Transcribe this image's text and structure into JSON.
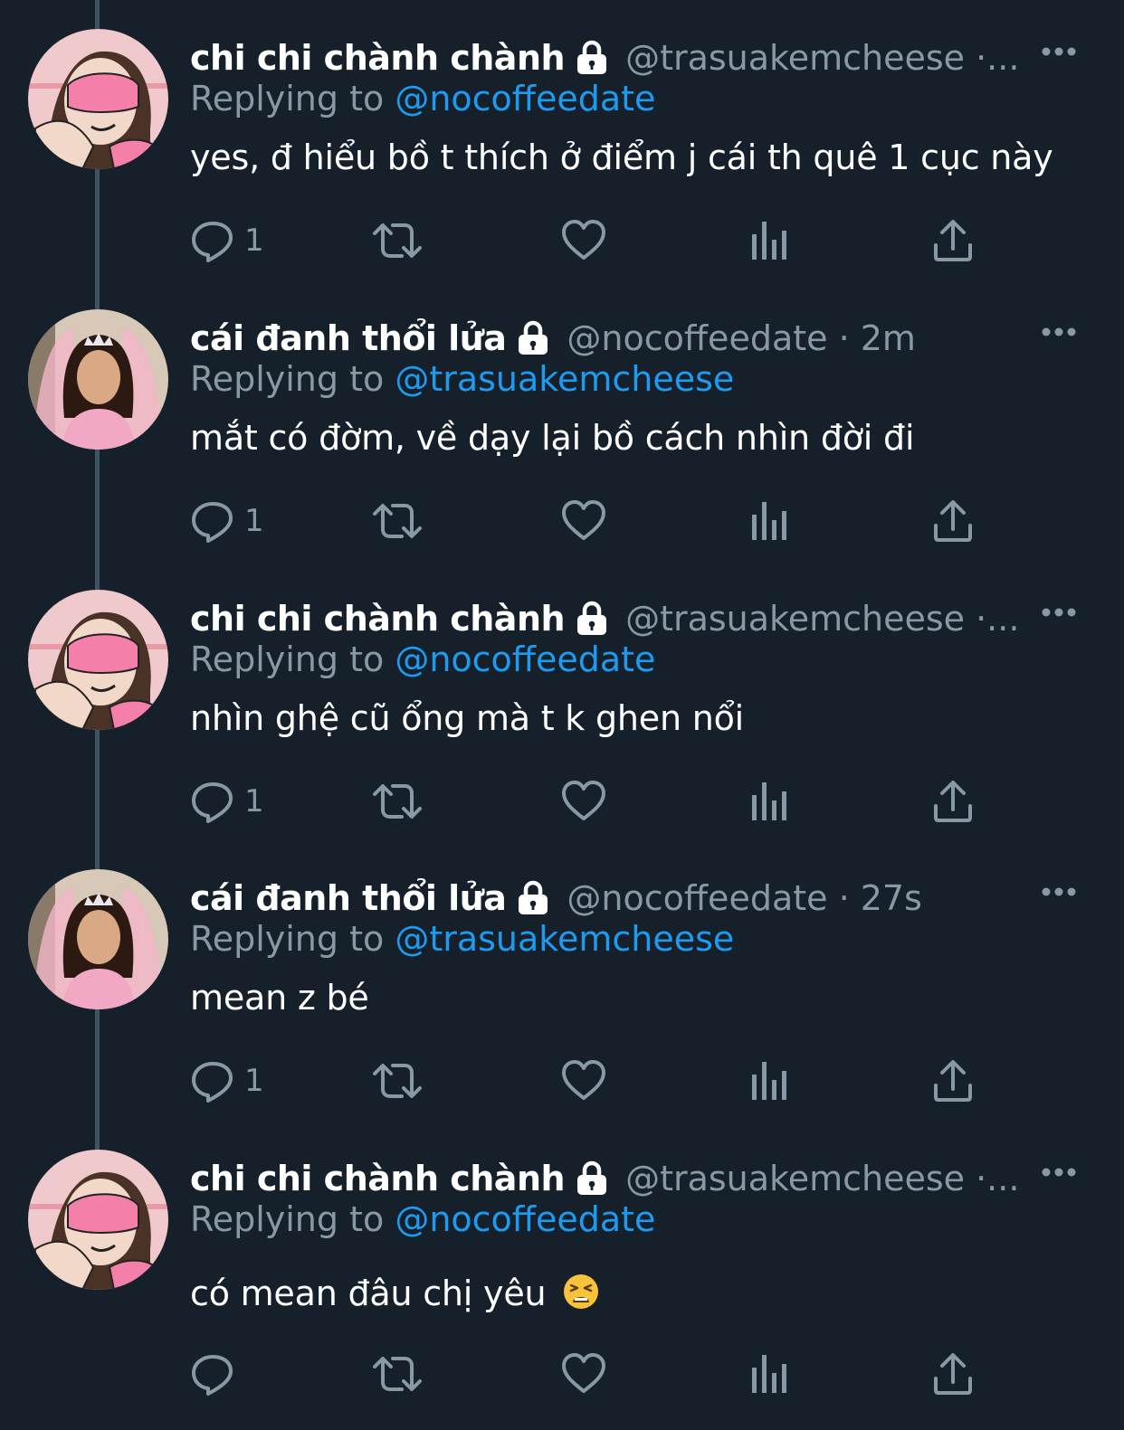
{
  "colors": {
    "background": "#15202b",
    "secondary_text": "#8899a6",
    "link": "#1d9bf0",
    "thread_line": "#3d5466"
  },
  "actions_icons": [
    "reply-icon",
    "retweet-icon",
    "like-icon",
    "analytics-icon",
    "share-icon"
  ],
  "tweets": [
    {
      "author_name": "chi chi chành chành",
      "handle_time": "@trasuakemcheese ·...",
      "reply_prefix": "Replying to ",
      "reply_handle": "@nocoffeedate",
      "text": "yes, đ hiểu bồ t thích ở điểm j cái th quê 1 cục này",
      "emoji": "",
      "reply_count": "1"
    },
    {
      "author_name": "cái đanh thổi lửa",
      "handle_time": "@nocoffeedate · 2m",
      "reply_prefix": "Replying to ",
      "reply_handle": "@trasuakemcheese",
      "text": "mắt có đờm, về dạy lại bồ cách nhìn đời đi",
      "emoji": "",
      "reply_count": "1"
    },
    {
      "author_name": "chi chi chành chành",
      "handle_time": "@trasuakemcheese ·...",
      "reply_prefix": "Replying to ",
      "reply_handle": "@nocoffeedate",
      "text": "nhìn ghệ cũ ổng mà t k ghen nổi",
      "emoji": "",
      "reply_count": "1"
    },
    {
      "author_name": "cái đanh thổi lửa",
      "handle_time": "@nocoffeedate · 27s",
      "reply_prefix": "Replying to ",
      "reply_handle": "@trasuakemcheese",
      "text": "mean z bé",
      "emoji": "",
      "reply_count": "1"
    },
    {
      "author_name": "chi chi chành chành",
      "handle_time": "@trasuakemcheese ·...",
      "reply_prefix": "Replying to ",
      "reply_handle": "@nocoffeedate",
      "text": "có mean đâu chị yêu",
      "emoji": "tired-face-emoji",
      "reply_count": ""
    }
  ]
}
